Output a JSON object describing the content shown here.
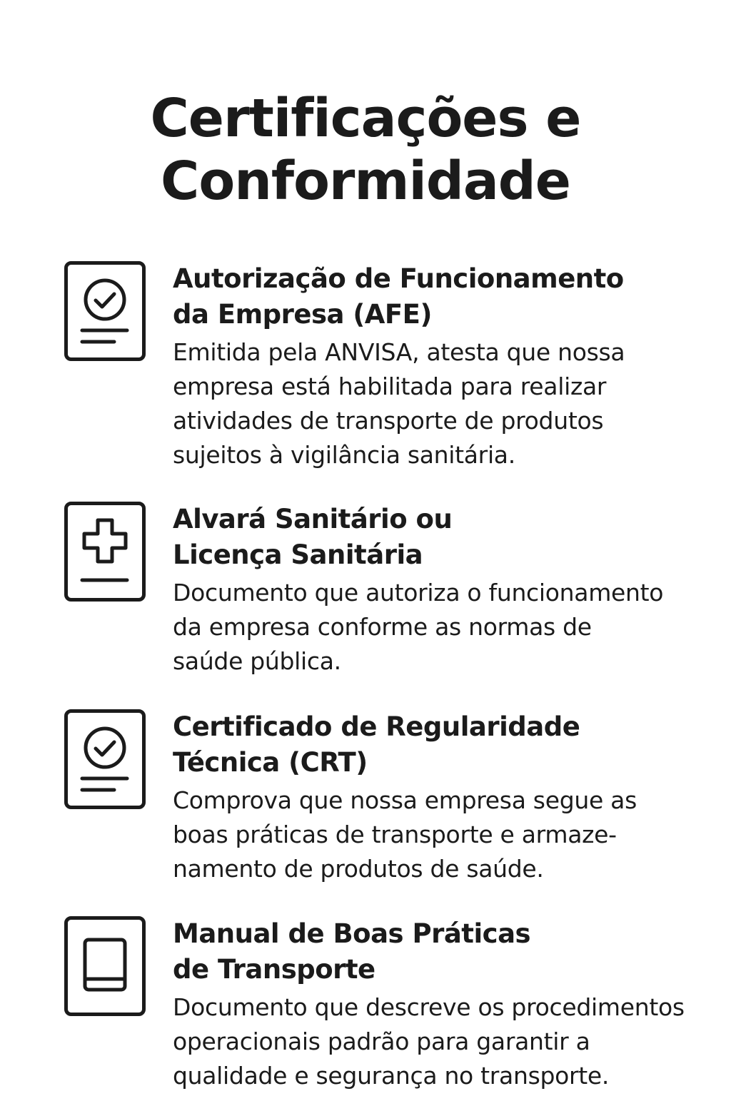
{
  "title": {
    "line1": "Certificações e",
    "line2": "Conformidade"
  },
  "items": [
    {
      "icon": "document-check-icon",
      "title_lines": [
        "Autorização de Funcionamento",
        "da Empresa (AFE)"
      ],
      "desc_lines": [
        "Emitida pela ANVISA, atesta que nossa",
        "empresa está habilitada para realizar",
        "atividades de transporte de produtos",
        "sujeitos à vigilância sanitária."
      ]
    },
    {
      "icon": "document-cross-icon",
      "title_lines": [
        "Alvará Sanitário ou",
        "Licença Sanitária"
      ],
      "desc_lines": [
        "Documento que autoriza o funcionamento",
        "da empresa conforme as normas de",
        "saúde pública."
      ]
    },
    {
      "icon": "document-check-icon",
      "title_lines": [
        "Certificado de Regularidade",
        "Técnica (CRT)"
      ],
      "desc_lines": [
        "Comprova que nossa empresa segue as",
        "boas práticas de transporte e armaze-",
        "namento de produtos de saúde."
      ]
    },
    {
      "icon": "document-book-icon",
      "title_lines": [
        "Manual de Boas Práticas",
        "de Transporte"
      ],
      "desc_lines": [
        "Documento que descreve os procedimentos",
        "operacionais padrão para garantir a",
        "qualidade e segurança no transporte."
      ]
    }
  ]
}
